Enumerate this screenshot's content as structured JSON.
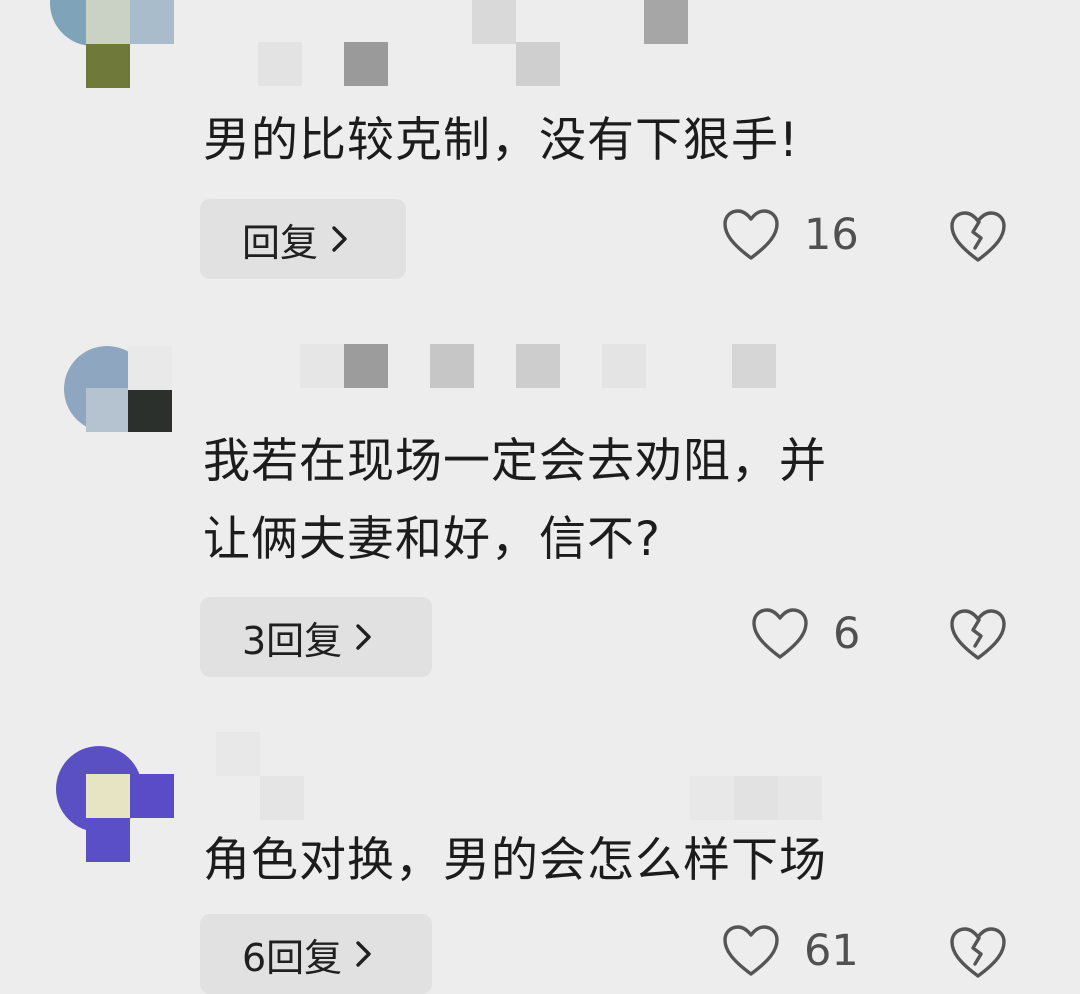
{
  "comments": [
    {
      "text": "男的比较克制，没有下狠手!",
      "reply_label": "回复",
      "like_count": "16"
    },
    {
      "text_line1": "我若在现场一定会去劝阻，并",
      "text_line2": "让俩夫妻和好，信不?",
      "reply_label": "3回复",
      "like_count": "6"
    },
    {
      "text": "角色对换，男的会怎么样下场",
      "reply_label": "6回复",
      "like_count": "61"
    }
  ],
  "icons": {
    "like": "heart-outline-icon",
    "dislike": "broken-heart-icon",
    "reply_chevron": "chevron-right-icon"
  },
  "colors": {
    "background": "#ededed",
    "button_bg": "#e1e1e1",
    "text": "#1c1c1c",
    "icon": "#505050"
  }
}
